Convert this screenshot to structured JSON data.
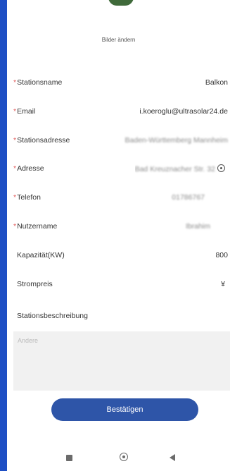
{
  "header": {
    "change_picture_label": "Bilder ändern"
  },
  "fields": [
    {
      "label": "Stationsname",
      "required": true,
      "value": "Balkon",
      "blurred": false
    },
    {
      "label": "Email",
      "required": true,
      "value": "i.koeroglu@ultrasolar24.de",
      "blurred": false
    },
    {
      "label": "Stationsadresse",
      "required": true,
      "value": "Baden-Württemberg Mannheim",
      "blurred": true
    },
    {
      "label": "Adresse",
      "required": true,
      "value": "Bad Kreuznacher Str. 32",
      "blurred": true
    },
    {
      "label": "Telefon",
      "required": true,
      "value": "01786767",
      "blurred": true
    },
    {
      "label": "Nutzername",
      "required": true,
      "value": "Ibrahim",
      "blurred": true
    },
    {
      "label": "Kapazität(KW)",
      "required": false,
      "value": "800",
      "blurred": false
    },
    {
      "label": "Strompreis",
      "required": false,
      "value": "¥",
      "blurred": false
    }
  ],
  "description": {
    "label": "Stationsbeschreibung",
    "placeholder": "Andere"
  },
  "confirm_label": "Bestätigen",
  "colors": {
    "frame": "#1e4fc4",
    "button": "#2e55a8",
    "required_star": "#e05a5a"
  },
  "icons": [
    "location-icon",
    "nav-square-icon",
    "nav-home-icon",
    "nav-back-icon"
  ]
}
